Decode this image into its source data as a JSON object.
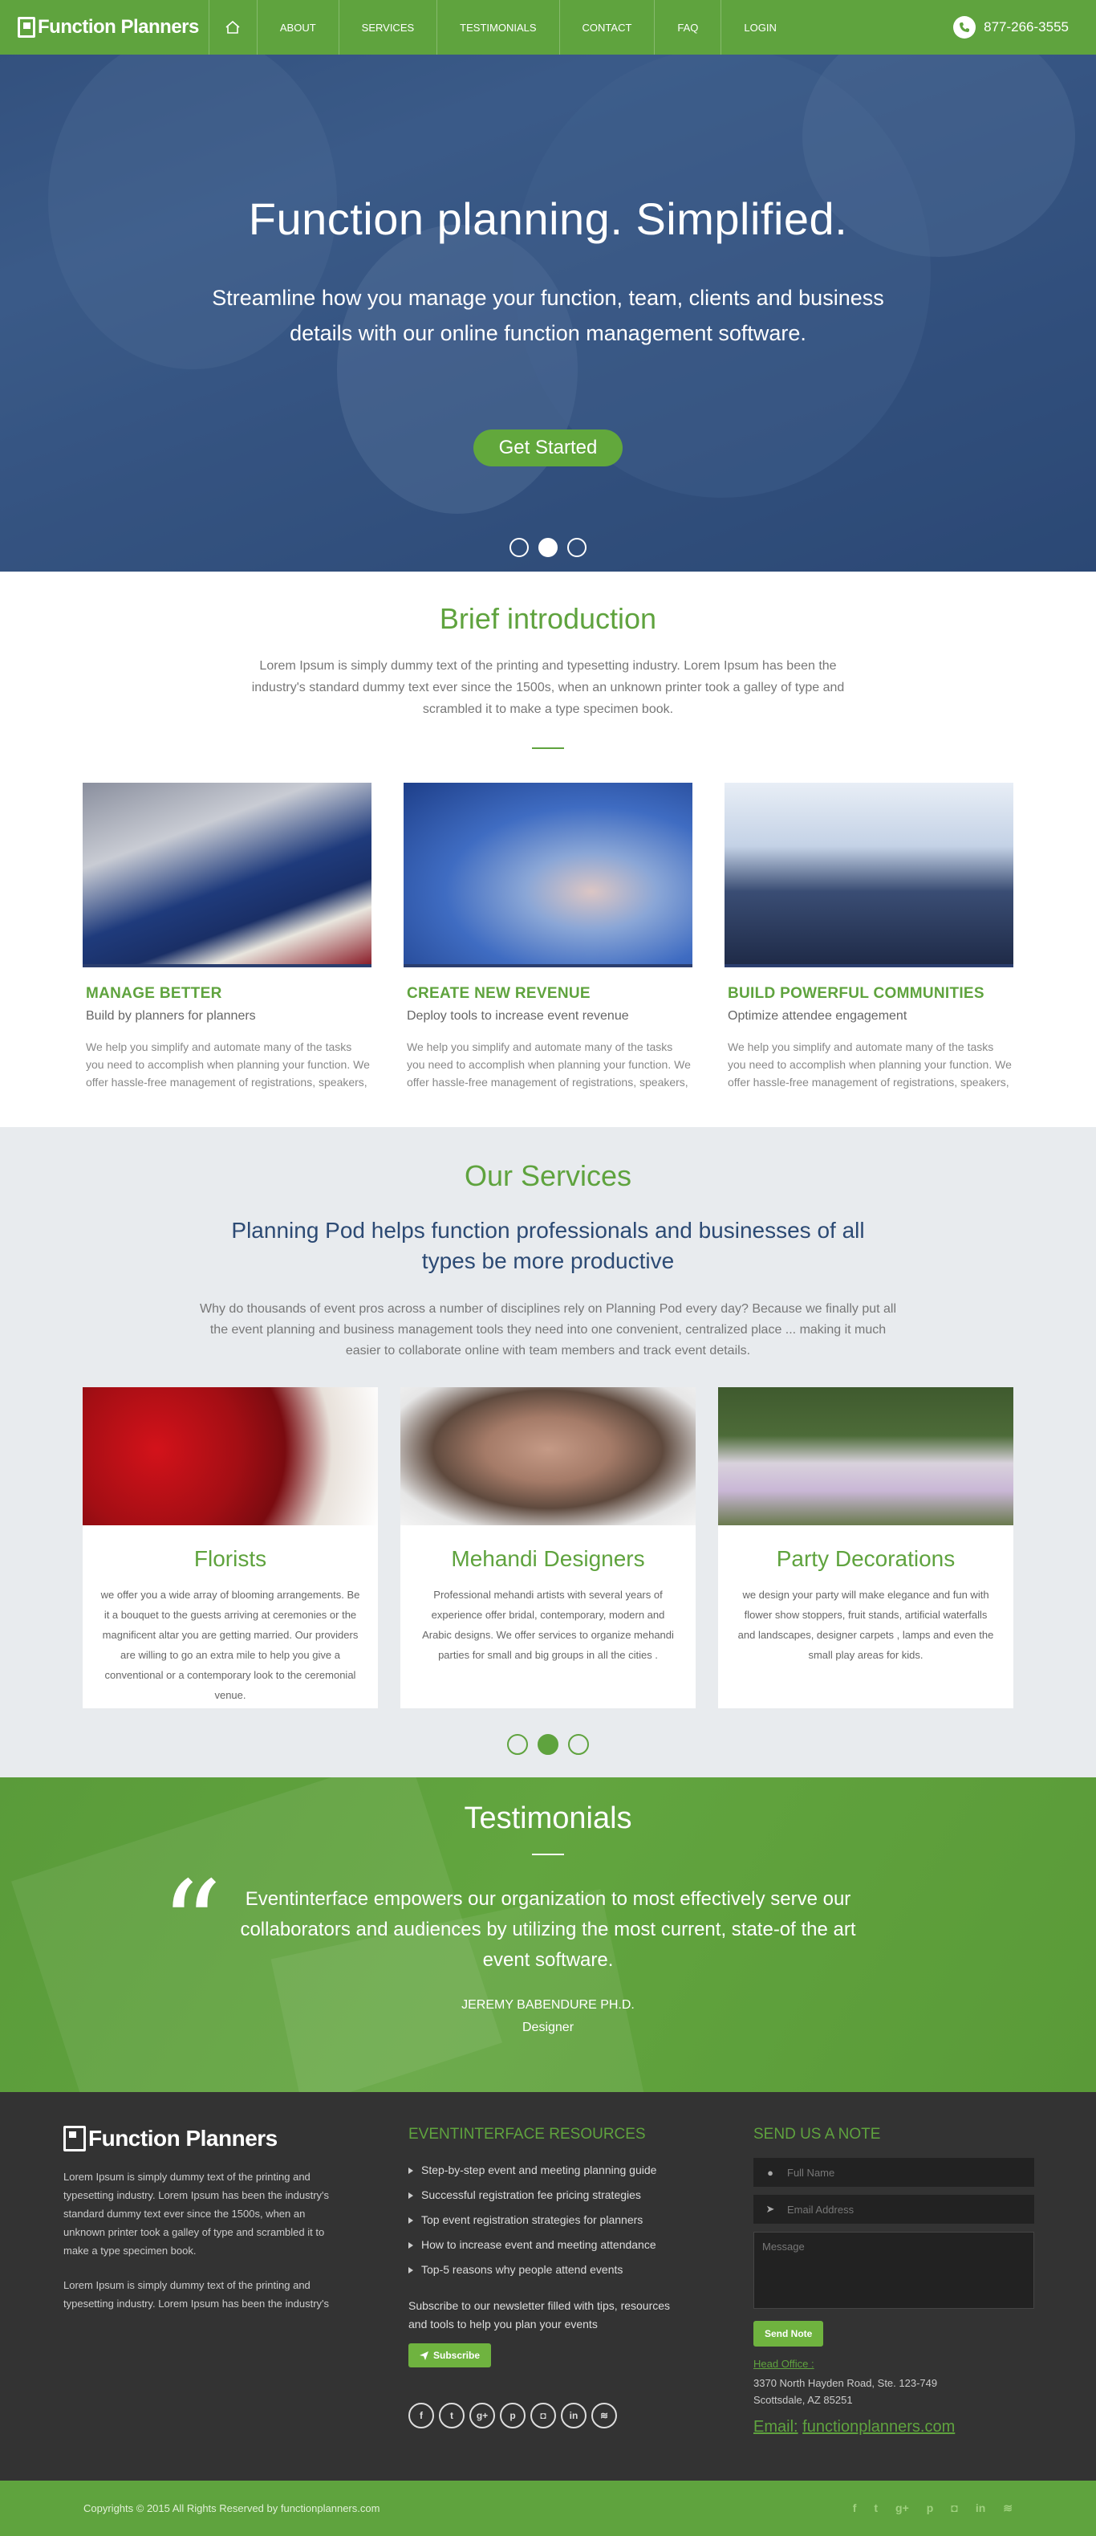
{
  "nav": {
    "logo": "Function Planners",
    "items": [
      "ABOUT",
      "SERVICES",
      "TESTIMONIALS",
      "CONTACT",
      "FAQ",
      "LOGIN"
    ],
    "phone": "877-266-3555"
  },
  "hero": {
    "title": "Function planning. Simplified.",
    "subtitle": "Streamline how you manage your function, team, clients and business details with our online function management software.",
    "cta": "Get Started",
    "slides": 3,
    "active_slide": 2
  },
  "intro": {
    "title": "Brief introduction",
    "text": "Lorem Ipsum is simply dummy text of the printing and typesetting industry. Lorem Ipsum has been the industry's standard dummy text ever since the 1500s, when an unknown printer took a galley of type and scrambled it to make a type specimen book.",
    "features": [
      {
        "title": "MANAGE BETTER",
        "tag": "Build by planners for planners",
        "text": "We help you simplify and automate many of the tasks you need to accomplish when planning your function. We offer hassle-free management of registrations, speakers,"
      },
      {
        "title": "CREATE NEW REVENUE",
        "tag": "Deploy tools to increase event revenue",
        "text": "We help you simplify and automate many of the tasks you need to accomplish when planning your function. We offer hassle-free management of registrations, speakers,"
      },
      {
        "title": "BUILD POWERFUL COMMUNITIES",
        "tag": "Optimize attendee engagement",
        "text": "We help you simplify and automate many of the tasks you need to accomplish when planning your function. We offer hassle-free management of registrations, speakers,"
      }
    ]
  },
  "services": {
    "title": "Our Services",
    "subtitle": "Planning Pod helps function professionals and businesses of all types be more productive",
    "text": "Why do thousands of event pros across a number of disciplines rely on Planning Pod every day? Because we finally put all the event planning and business management tools they need into one convenient, centralized place ... making it much easier to collaborate online with team members and track event details.",
    "cards": [
      {
        "title": "Florists",
        "text": "we offer you a wide array of blooming arrangements. Be it a bouquet to the guests arriving at ceremonies or the magnificent altar you are getting married. Our providers are willing to go an extra mile to help you give a conventional or a contemporary look to the ceremonial venue."
      },
      {
        "title": "Mehandi Designers",
        "text": "Professional mehandi artists with several years of experience offer bridal, contemporary, modern and Arabic designs. We offer services to organize mehandi parties for small and big groups in all the cities ."
      },
      {
        "title": "Party Decorations",
        "text": "we design your party  will make elegance and fun with flower  show stoppers, fruit stands, artificial waterfalls and landscapes, designer carpets , lamps and even the small play areas for kids."
      }
    ],
    "active_slide": 2
  },
  "testimonials": {
    "title": "Testimonials",
    "quote": "Eventinterface empowers our organization to most effectively serve our collaborators and audiences by utilizing the most current, state-of the art event software.",
    "name": "JEREMY BABENDURE PH.D.",
    "role": "Designer"
  },
  "footer": {
    "logo": "Function Planners",
    "about1": "Lorem Ipsum is simply dummy text of the printing and typesetting industry. Lorem Ipsum has been the industry's standard dummy text ever since the 1500s, when an unknown printer took a galley of type and scrambled it to make a type specimen book.",
    "about2": "Lorem Ipsum is simply dummy text of the printing and typesetting industry. Lorem Ipsum has been the industry's",
    "resources_title": "EVENTINTERFACE RESOURCES",
    "resources": [
      "Step-by-step event and meeting planning guide",
      "Successful registration fee pricing strategies",
      "Top event registration strategies for planners",
      "How to increase event and meeting attendance",
      "Top-5 reasons why people attend events"
    ],
    "newsletter": "Subscribe to our newsletter filled with tips, resources and tools to help you plan your events",
    "subscribe": "Subscribe",
    "socials": [
      "f",
      "t",
      "g+",
      "p",
      "in-cam",
      "in",
      "rss"
    ],
    "note_title": "SEND US A NOTE",
    "name_placeholder": "Full Name",
    "email_placeholder": "Email Address",
    "message_placeholder": "Message",
    "send": "Send Note",
    "office_label": "Head Office :",
    "address_line1": "3370 North Hayden Road, Ste. 123-749",
    "address_line2": "Scottsdale, AZ 85251",
    "email_label": "Email:",
    "email": "functionplanners.com"
  },
  "bottom": {
    "copyright": "Copyrights © 2015 All Rights Reserved by functionplanners.com"
  },
  "colors": {
    "brand_green": "#5fa33e",
    "dark_blue": "#2c4a74",
    "footer_dark": "#333333"
  }
}
